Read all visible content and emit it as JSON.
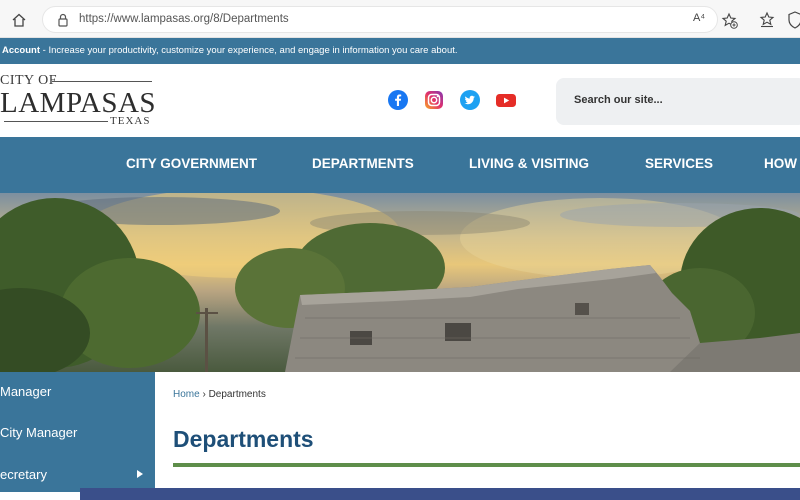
{
  "browser": {
    "url": "https://www.lampasas.org/8/Departments",
    "read_aloud_label": "A⁴"
  },
  "account_strip": {
    "bold": "Account",
    "text": " - Increase your productivity, customize your experience, and engage in information you care about."
  },
  "logo": {
    "city_of": "CITY OF",
    "name": "LAMPASAS",
    "state": "TEXAS"
  },
  "social": [
    "facebook-icon",
    "instagram-icon",
    "twitter-icon",
    "youtube-icon"
  ],
  "search": {
    "placeholder": "Search our site..."
  },
  "nav": {
    "items": [
      "CITY GOVERNMENT",
      "DEPARTMENTS",
      "LIVING & VISITING",
      "SERVICES",
      "HOW"
    ]
  },
  "sidebar": {
    "items": [
      "Manager",
      "City Manager",
      "ecretary"
    ]
  },
  "breadcrumb": {
    "home": "Home",
    "separator": " › ",
    "current": "Departments"
  },
  "page": {
    "title": "Departments"
  },
  "colors": {
    "brand_blue": "#3a759a",
    "title_blue": "#1e4f78",
    "rule_green": "#5e8e4a"
  }
}
